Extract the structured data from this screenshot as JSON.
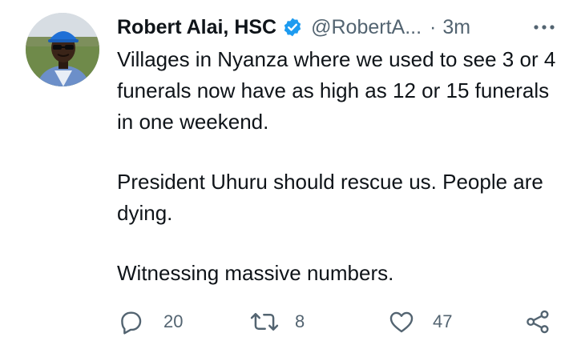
{
  "tweet": {
    "author_name": "Robert Alai, HSC",
    "handle": "@RobertA...",
    "separator": "·",
    "time": "3m",
    "paragraphs": [
      "Villages in Nyanza where we used to see 3 or 4 funerals now have as high as 12 or 15 funerals in one weekend.",
      "President Uhuru should rescue us. People are dying.",
      "Witnessing massive numbers."
    ]
  },
  "actions": {
    "reply_count": "20",
    "retweet_count": "8",
    "like_count": "47"
  },
  "icons": {
    "verified": "verified-badge-icon",
    "more": "more-horizontal-icon",
    "reply": "reply-icon",
    "retweet": "retweet-icon",
    "like": "heart-icon",
    "share": "share-icon"
  },
  "colors": {
    "verified_blue": "#1d9bf0",
    "secondary_text": "#536471",
    "primary_text": "#0f1419"
  }
}
